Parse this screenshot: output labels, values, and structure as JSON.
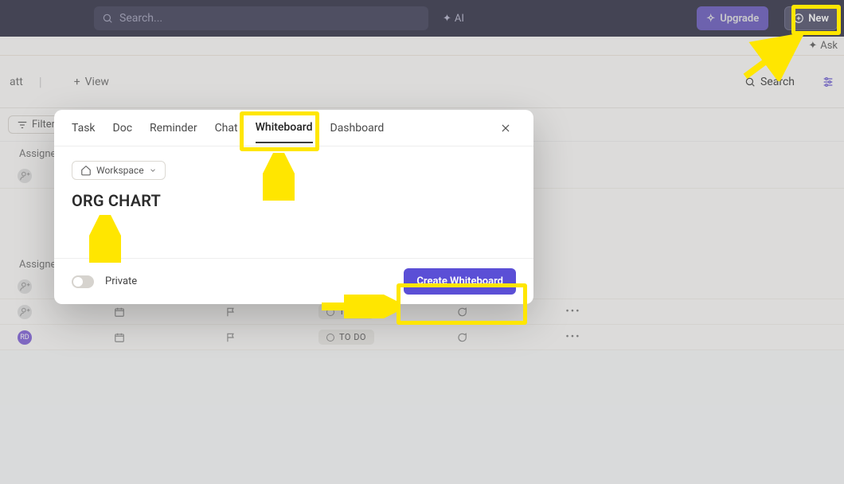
{
  "topbar": {
    "search_placeholder": "Search...",
    "ai_label": "AI",
    "upgrade_label": "Upgrade",
    "new_label": "New"
  },
  "ask_label": "Ask",
  "page": {
    "crumb_tail": "att",
    "add_view_label": "View",
    "search_label": "Search"
  },
  "filters_label": "Filters",
  "group_label": "Assignee",
  "status_label": "TO DO",
  "avatar_initials": "RD",
  "modal": {
    "tabs": {
      "task": "Task",
      "doc": "Doc",
      "reminder": "Reminder",
      "chat": "Chat",
      "whiteboard": "Whiteboard",
      "dashboard": "Dashboard"
    },
    "workspace_chip": "Workspace",
    "title_value": "ORG CHART",
    "private_label": "Private",
    "create_label": "Create Whiteboard"
  }
}
